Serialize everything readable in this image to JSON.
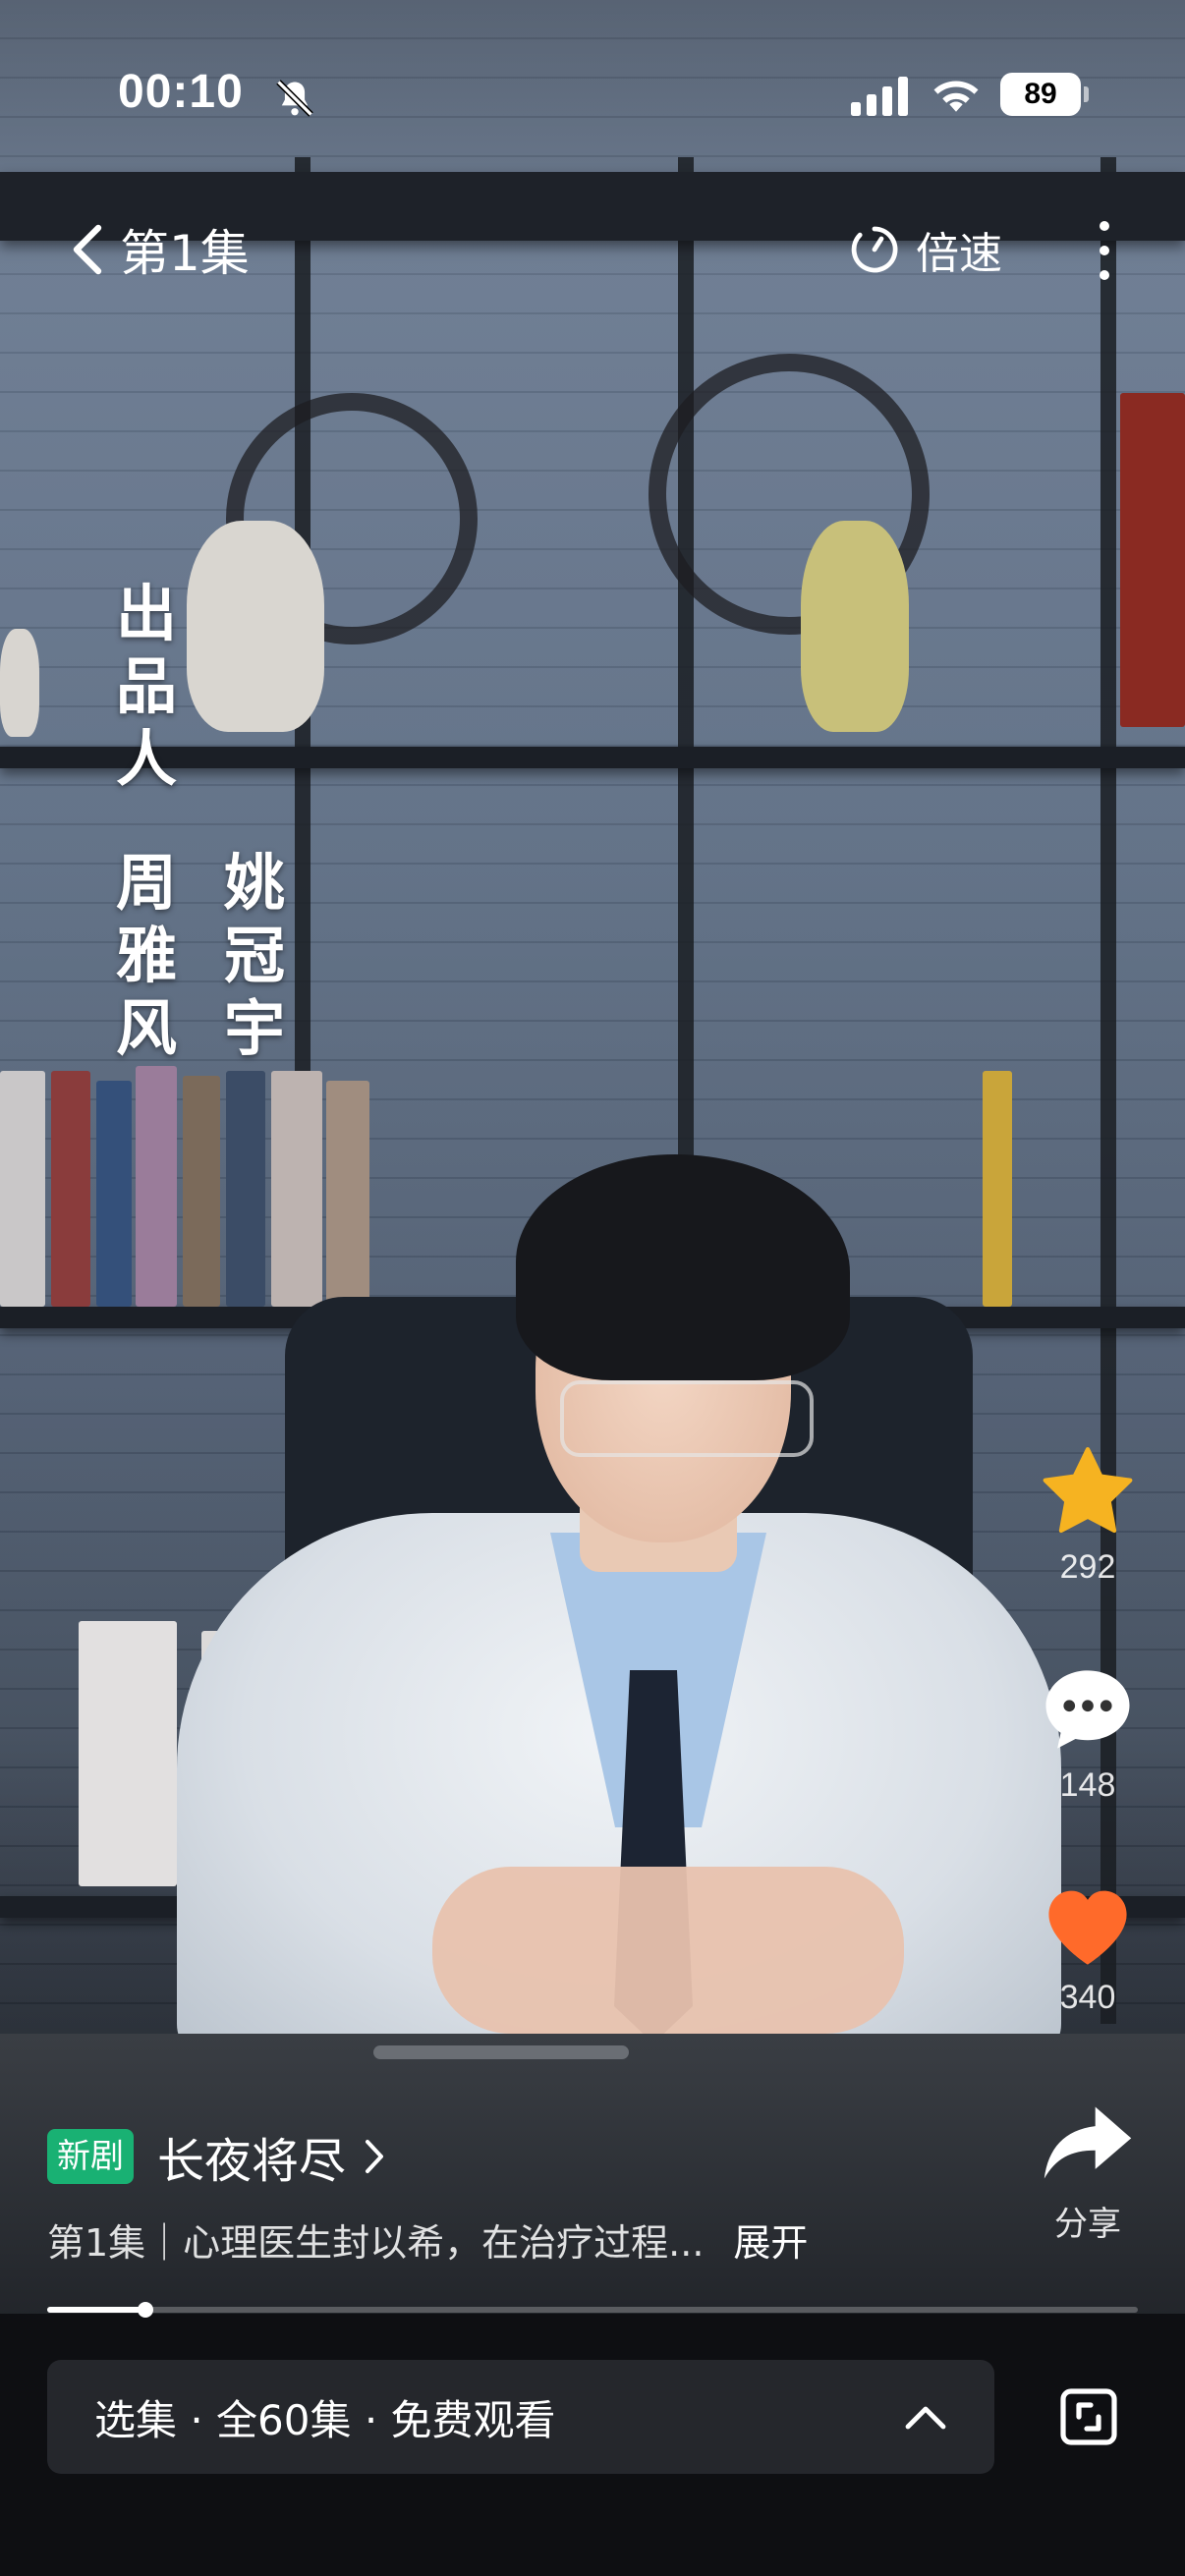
{
  "status_bar": {
    "time": "00:10",
    "battery": "89",
    "icons": [
      "bell-slash-icon",
      "signal-bars-icon",
      "wifi-icon",
      "battery-icon"
    ]
  },
  "top_bar": {
    "back_icon": "chevron-left-icon",
    "episode_title": "第1集",
    "speed_icon": "speed-dial-icon",
    "speed_label": "倍速",
    "more_icon": "more-vertical-icon"
  },
  "video": {
    "credit_heading": [
      "出",
      "品",
      "人"
    ],
    "credit_name_1": [
      "周",
      "雅",
      "风"
    ],
    "credit_name_2": [
      "姚",
      "冠",
      "宇"
    ]
  },
  "actions": {
    "favorite": {
      "icon": "star-icon",
      "count": "292",
      "color": "#f6b321"
    },
    "comment": {
      "icon": "comment-bubble-icon",
      "count": "148"
    },
    "like": {
      "icon": "heart-icon",
      "count": "340",
      "color": "#ff6a2a"
    },
    "share": {
      "icon": "share-arrow-icon",
      "label": "分享"
    }
  },
  "drama": {
    "tag": "新剧",
    "name": "长夜将尽",
    "description": "第1集｜心理医生封以希，在治疗过程...",
    "expand": "展开"
  },
  "progress": {
    "fraction": 0.09
  },
  "episode_bar": {
    "label": "选集 · 全60集 · 免费观看",
    "icon": "chevron-up-icon"
  },
  "fullscreen_icon": "fullscreen-rotate-icon",
  "colors": {
    "tag_green": "#19b173",
    "bar_bg": "#25272c"
  }
}
